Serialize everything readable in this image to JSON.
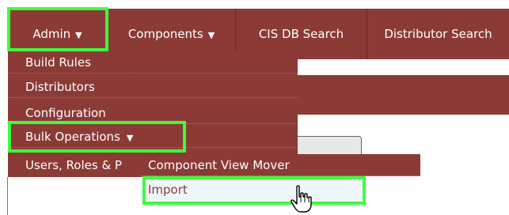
{
  "nav": {
    "admin": {
      "label": "Admin",
      "icon": "caret-down-icon"
    },
    "components": {
      "label": "Components",
      "icon": "caret-down-icon"
    },
    "cis_db_search": {
      "label": "CIS DB Search"
    },
    "distributor_search": {
      "label": "Distributor Search"
    }
  },
  "admin_menu": {
    "items": [
      {
        "label": "Build Rules"
      },
      {
        "label": "Distributors"
      },
      {
        "label": "Configuration"
      },
      {
        "label": "Bulk Operations",
        "icon": "caret-down-icon"
      },
      {
        "label": "Users, Roles & P"
      }
    ]
  },
  "bulk_submenu": {
    "items": [
      {
        "label": "Component View Mover"
      },
      {
        "label": "Import"
      }
    ]
  },
  "colors": {
    "menu_bg": "#8b3a36",
    "highlight": "#3cff3c",
    "hover_bg": "#eef6fb",
    "hover_text": "#8b3a36"
  }
}
